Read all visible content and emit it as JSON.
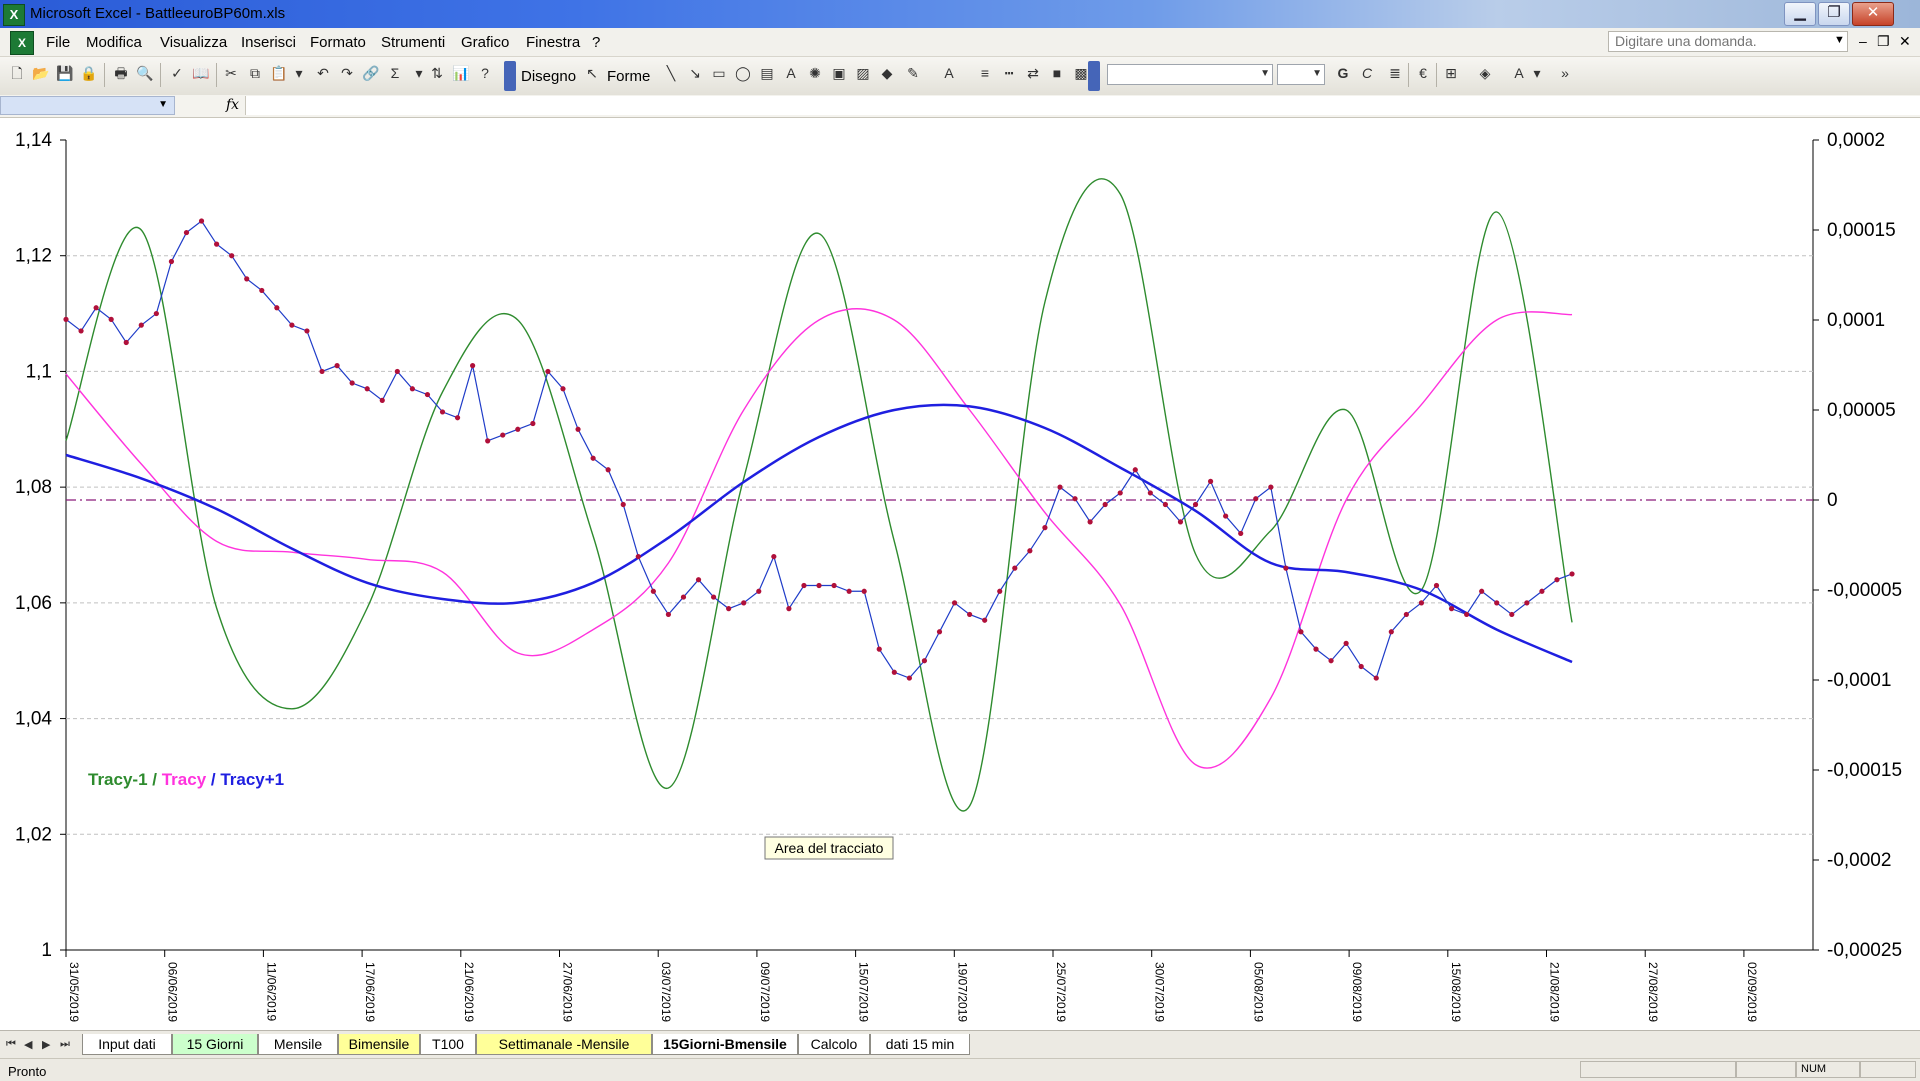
{
  "window": {
    "title": "Microsoft Excel - BattleeuroBP60m.xls",
    "app_icon": "excel-icon",
    "controls": {
      "minimize": "▁",
      "maximize": "❐",
      "close": "✕"
    }
  },
  "menubar": {
    "items": [
      "File",
      "Modifica",
      "Visualizza",
      "Inserisci",
      "Formato",
      "Strumenti",
      "Grafico",
      "Finestra",
      "?"
    ],
    "help_placeholder": "Digitare una domanda.",
    "mdi_controls": {
      "minimize": "–",
      "restore": "❐",
      "close": "✕"
    }
  },
  "toolbar": {
    "drawing_label": "Disegno",
    "shapes_label": "Forme"
  },
  "chart": {
    "legend": {
      "tracy_minus_1": "Tracy-1",
      "sep1": " / ",
      "tracy": "Tracy",
      "sep2": " / ",
      "tracy_plus_1": "Tracy+1"
    },
    "tooltip": "Area del tracciato",
    "colors": {
      "price": "#1f3cc8",
      "price_marker": "#b0103a",
      "tracy_minus_1": "#2e8b2e",
      "tracy": "#ff33dd",
      "tracy_plus_1": "#1f1fe0",
      "reference": "#8a1a7a",
      "grid": "#c0c0c0"
    }
  },
  "chart_data": {
    "type": "line",
    "xlabel": "",
    "ylabel": "",
    "x_tick_labels": [
      "31/05/2019",
      "06/06/2019",
      "11/06/2019",
      "17/06/2019",
      "21/06/2019",
      "27/06/2019",
      "03/07/2019",
      "09/07/2019",
      "15/07/2019",
      "19/07/2019",
      "25/07/2019",
      "30/07/2019",
      "05/08/2019",
      "09/08/2019",
      "15/08/2019",
      "21/08/2019",
      "27/08/2019",
      "02/09/2019"
    ],
    "y_left": {
      "ylim": [
        1,
        1.14
      ],
      "ticks": [
        "1,14",
        "1,12",
        "1,1",
        "1,08",
        "1,06",
        "1,04",
        "1,02",
        "1"
      ]
    },
    "y_right": {
      "ylim": [
        -0.00025,
        0.0002
      ],
      "ticks": [
        "0,0002",
        "0,00015",
        "0,0001",
        "0,00005",
        "0",
        "-0,00005",
        "-0,0001",
        "-0,00015",
        "-0,0002",
        "-0,00025"
      ]
    },
    "reference_line": {
      "axis": "right",
      "value": 0
    },
    "grid": "horizontal-dashed",
    "series": [
      {
        "name": "",
        "axis": "left",
        "markers": true,
        "points": [
          [
            0,
            1.109
          ],
          [
            2,
            1.107
          ],
          [
            4,
            1.111
          ],
          [
            6,
            1.109
          ],
          [
            8,
            1.105
          ],
          [
            10,
            1.108
          ],
          [
            12,
            1.11
          ],
          [
            14,
            1.119
          ],
          [
            16,
            1.124
          ],
          [
            18,
            1.126
          ],
          [
            20,
            1.122
          ],
          [
            22,
            1.12
          ],
          [
            24,
            1.116
          ],
          [
            26,
            1.114
          ],
          [
            28,
            1.111
          ],
          [
            30,
            1.108
          ],
          [
            32,
            1.107
          ],
          [
            34,
            1.1
          ],
          [
            36,
            1.101
          ],
          [
            38,
            1.098
          ],
          [
            40,
            1.097
          ],
          [
            42,
            1.095
          ],
          [
            44,
            1.1
          ],
          [
            46,
            1.097
          ],
          [
            48,
            1.096
          ],
          [
            50,
            1.093
          ],
          [
            52,
            1.092
          ],
          [
            54,
            1.101
          ],
          [
            56,
            1.088
          ],
          [
            58,
            1.089
          ],
          [
            60,
            1.09
          ],
          [
            62,
            1.091
          ],
          [
            64,
            1.1
          ],
          [
            66,
            1.097
          ],
          [
            68,
            1.09
          ],
          [
            70,
            1.085
          ],
          [
            72,
            1.083
          ],
          [
            74,
            1.077
          ],
          [
            76,
            1.068
          ],
          [
            78,
            1.062
          ],
          [
            80,
            1.058
          ],
          [
            82,
            1.061
          ],
          [
            84,
            1.064
          ],
          [
            86,
            1.061
          ],
          [
            88,
            1.059
          ],
          [
            90,
            1.06
          ],
          [
            92,
            1.062
          ],
          [
            94,
            1.068
          ],
          [
            96,
            1.059
          ],
          [
            98,
            1.063
          ],
          [
            100,
            1.063
          ],
          [
            102,
            1.063
          ],
          [
            104,
            1.062
          ],
          [
            106,
            1.062
          ],
          [
            108,
            1.052
          ],
          [
            110,
            1.048
          ],
          [
            112,
            1.047
          ],
          [
            114,
            1.05
          ],
          [
            116,
            1.055
          ],
          [
            118,
            1.06
          ],
          [
            120,
            1.058
          ],
          [
            122,
            1.057
          ],
          [
            124,
            1.062
          ],
          [
            126,
            1.066
          ],
          [
            128,
            1.069
          ],
          [
            130,
            1.073
          ],
          [
            132,
            1.08
          ],
          [
            134,
            1.078
          ],
          [
            136,
            1.074
          ],
          [
            138,
            1.077
          ],
          [
            140,
            1.079
          ],
          [
            142,
            1.083
          ],
          [
            144,
            1.079
          ],
          [
            146,
            1.077
          ],
          [
            148,
            1.074
          ],
          [
            150,
            1.077
          ],
          [
            152,
            1.081
          ],
          [
            154,
            1.075
          ],
          [
            156,
            1.072
          ],
          [
            158,
            1.078
          ],
          [
            160,
            1.08
          ],
          [
            162,
            1.066
          ],
          [
            164,
            1.055
          ],
          [
            166,
            1.052
          ],
          [
            168,
            1.05
          ],
          [
            170,
            1.053
          ],
          [
            172,
            1.049
          ],
          [
            174,
            1.047
          ],
          [
            176,
            1.055
          ],
          [
            178,
            1.058
          ],
          [
            180,
            1.06
          ],
          [
            182,
            1.063
          ],
          [
            184,
            1.059
          ],
          [
            186,
            1.058
          ],
          [
            188,
            1.062
          ],
          [
            190,
            1.06
          ],
          [
            192,
            1.058
          ],
          [
            194,
            1.06
          ],
          [
            196,
            1.062
          ],
          [
            198,
            1.064
          ],
          [
            200,
            1.065
          ]
        ]
      },
      {
        "name": "Tracy-1",
        "axis": "right",
        "points": [
          [
            0,
            3.3e-05
          ],
          [
            10,
            0.00015
          ],
          [
            20,
            -6e-05
          ],
          [
            30,
            -0.000116
          ],
          [
            40,
            -6e-05
          ],
          [
            50,
            6e-05
          ],
          [
            60,
            0.0001
          ],
          [
            70,
            -2e-05
          ],
          [
            80,
            -0.00016
          ],
          [
            90,
            1.2e-05
          ],
          [
            100,
            0.000148
          ],
          [
            110,
            -2.3e-05
          ],
          [
            120,
            -0.00017
          ],
          [
            130,
            0.00011
          ],
          [
            140,
            0.00017
          ],
          [
            150,
            -3e-05
          ],
          [
            160,
            -1.7e-05
          ],
          [
            170,
            5e-05
          ],
          [
            180,
            -5e-05
          ],
          [
            190,
            0.00016
          ],
          [
            200,
            -6.8e-05
          ]
        ]
      },
      {
        "name": "Tracy",
        "axis": "right",
        "points": [
          [
            0,
            7e-05
          ],
          [
            10,
            2e-05
          ],
          [
            20,
            -2.3e-05
          ],
          [
            30,
            -2.9e-05
          ],
          [
            40,
            -3.3e-05
          ],
          [
            50,
            -4e-05
          ],
          [
            60,
            -8.5e-05
          ],
          [
            70,
            -7.2e-05
          ],
          [
            80,
            -3.5e-05
          ],
          [
            90,
            5e-05
          ],
          [
            100,
            0.0001
          ],
          [
            110,
            0.0001
          ],
          [
            120,
            5e-05
          ],
          [
            130,
            -7e-06
          ],
          [
            140,
            -5.8e-05
          ],
          [
            150,
            -0.000147
          ],
          [
            160,
            -0.00011
          ],
          [
            170,
            0
          ],
          [
            180,
            5.3e-05
          ],
          [
            190,
            0.0001
          ],
          [
            200,
            0.000103
          ]
        ]
      },
      {
        "name": "Tracy+1",
        "axis": "right",
        "points": [
          [
            0,
            2.5e-05
          ],
          [
            10,
            1.2e-05
          ],
          [
            20,
            -5e-06
          ],
          [
            30,
            -2.7e-05
          ],
          [
            40,
            -4.6e-05
          ],
          [
            50,
            -5.5e-05
          ],
          [
            60,
            -5.7e-05
          ],
          [
            70,
            -4.6e-05
          ],
          [
            80,
            -2.1e-05
          ],
          [
            90,
            1e-05
          ],
          [
            100,
            3.5e-05
          ],
          [
            110,
            5e-05
          ],
          [
            120,
            5.2e-05
          ],
          [
            130,
            4e-05
          ],
          [
            140,
            1.8e-05
          ],
          [
            150,
            -6e-06
          ],
          [
            160,
            -3.5e-05
          ],
          [
            170,
            -4e-05
          ],
          [
            180,
            -5e-05
          ],
          [
            190,
            -7.2e-05
          ],
          [
            200,
            -9e-05
          ]
        ]
      }
    ]
  },
  "sheet_tabs": {
    "items": [
      {
        "label": "Input dati",
        "color": "white"
      },
      {
        "label": "15 Giorni",
        "color": "green"
      },
      {
        "label": "Mensile",
        "color": "white"
      },
      {
        "label": "Bimensile",
        "color": "yellow"
      },
      {
        "label": "T100",
        "color": "white"
      },
      {
        "label": "Settimanale -Mensile",
        "color": "yellow"
      },
      {
        "label": "15Giorni-Bmensile",
        "color": "active"
      },
      {
        "label": "Calcolo",
        "color": "white"
      },
      {
        "label": "dati 15 min",
        "color": "white"
      }
    ],
    "nav": [
      "⏮",
      "◀",
      "▶",
      "⏭"
    ]
  },
  "statusbar": {
    "status": "Pronto",
    "num": "NUM"
  }
}
